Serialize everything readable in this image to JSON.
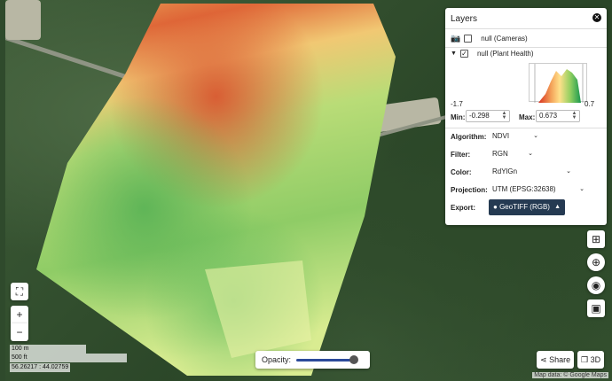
{
  "layers_panel": {
    "title": "Layers",
    "cameras_label": "null (Cameras)",
    "plant_health_label": "null (Plant Health)",
    "hist_min": "-1.7",
    "hist_max": "0.7",
    "min_label": "Min:",
    "min_value": "-0.298",
    "max_label": "Max:",
    "max_value": "0.673",
    "algorithm_label": "Algorithm:",
    "algorithm_value": "NDVI",
    "filter_label": "Filter:",
    "filter_value": "RGN",
    "color_label": "Color:",
    "color_value": "RdYlGn",
    "projection_label": "Projection:",
    "projection_value": "UTM (EPSG:32638)",
    "export_label": "Export:",
    "export_value": "GeoTIFF (RGB)"
  },
  "controls": {
    "opacity_label": "Opacity:",
    "opacity_value": 0.95,
    "share_label": "Share",
    "three_d_label": "3D",
    "zoom_in": "+",
    "zoom_out": "−"
  },
  "scale": {
    "meters": "100 m",
    "feet": "500 ft",
    "coords": "56.26217 : 44.02759"
  },
  "attribution": "Map data: © Google Maps",
  "colors": {
    "accent": "#253a52",
    "slider": "#2c4a9a"
  },
  "icons": [
    "camera-icon",
    "close-icon",
    "fullscreen-icon",
    "layers-grid-icon",
    "plus-circle-icon",
    "eye-icon",
    "square-icon",
    "share-icon",
    "cube-icon"
  ]
}
